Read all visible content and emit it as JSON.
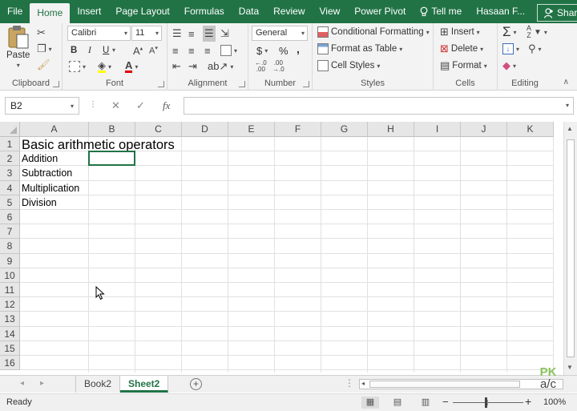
{
  "ribbon_tabs": [
    {
      "label": "File"
    },
    {
      "label": "Home",
      "active": true
    },
    {
      "label": "Insert"
    },
    {
      "label": "Page Layout"
    },
    {
      "label": "Formulas"
    },
    {
      "label": "Data"
    },
    {
      "label": "Review"
    },
    {
      "label": "View"
    },
    {
      "label": "Power Pivot"
    }
  ],
  "tell_me": "Tell me",
  "user": "Hasaan F...",
  "share_label": "Share",
  "accent_color": "#217346",
  "clipboard": {
    "paste_label": "Paste",
    "group_label": "Clipboard"
  },
  "font": {
    "family": "Calibri",
    "size": "11",
    "group_label": "Font",
    "bold": "B",
    "italic": "I",
    "underline": "U",
    "font_color_glyph": "A"
  },
  "alignment": {
    "group_label": "Alignment"
  },
  "number": {
    "format": "General",
    "currency": "$",
    "percent": "%",
    "comma": ",",
    "group_label": "Number"
  },
  "styles": {
    "conditional_formatting": "Conditional Formatting",
    "format_as_table": "Format as Table",
    "cell_styles": "Cell Styles",
    "group_label": "Styles"
  },
  "cells": {
    "insert": "Insert",
    "delete": "Delete",
    "format": "Format",
    "group_label": "Cells"
  },
  "editing": {
    "group_label": "Editing"
  },
  "formula_bar": {
    "name_box": "B2",
    "fx": "fx",
    "content": ""
  },
  "columns": [
    "A",
    "B",
    "C",
    "D",
    "E",
    "F",
    "G",
    "H",
    "I",
    "J",
    "K"
  ],
  "rows": [
    "1",
    "2",
    "3",
    "4",
    "5",
    "6",
    "7",
    "8",
    "9",
    "10",
    "11",
    "12",
    "13",
    "14",
    "15",
    "16"
  ],
  "cells_data": {
    "A1": "Basic arithmetic operators",
    "A2": "Addition",
    "A3": "Subtraction",
    "A4": "Multiplication",
    "A5": "Division"
  },
  "selected_cell": "B2",
  "sheets": [
    {
      "label": "Book2",
      "active": false
    },
    {
      "label": "Sheet2",
      "active": true
    }
  ],
  "status": {
    "ready": "Ready",
    "zoom": "100%"
  },
  "watermark": {
    "line1": "PK",
    "line2": "a/c"
  }
}
